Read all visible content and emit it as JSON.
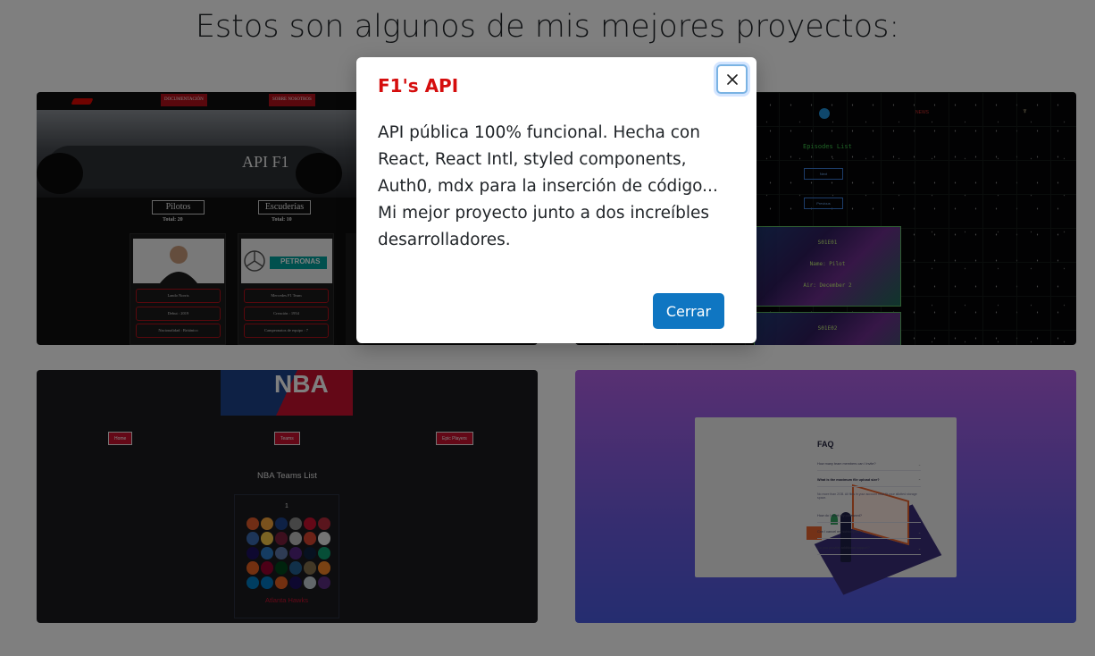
{
  "page": {
    "title": "Estos son algunos de mis mejores proyectos:"
  },
  "projects": {
    "f1": {
      "nav_buttons": [
        "DOCUMENTACIÓN",
        "SOBRE NOSOTROS"
      ],
      "hero_title": "API F1",
      "tabs": [
        {
          "label": "Pilotos",
          "total": "Total: 20"
        },
        {
          "label": "Escuderías",
          "total": "Total: 10"
        }
      ],
      "driver_card": [
        "Lando Norris",
        "Debut : 2019",
        "Nacionalidad : Británico"
      ],
      "team_card": [
        "Mercedes F1 Team",
        "Creación : 1954",
        "Campeonatos de equipo : 7"
      ],
      "sponsor_text": "PETRONAS"
    },
    "rick_morty": {
      "nav_link": "NEWS",
      "heading": "Episodes List",
      "buttons": [
        "Next",
        "Previous"
      ],
      "episode_1": [
        "S01E01",
        "Name: Pilot",
        "Air: December 2"
      ],
      "episode_2": [
        "S01E02"
      ]
    },
    "nba": {
      "logo_text": "NBA",
      "nav_buttons": [
        "Home",
        "Teams",
        "Epic Players"
      ],
      "list_title": "NBA Teams List",
      "page_number": "1",
      "team_name": "Atlanta Hawks"
    },
    "faq": {
      "title": "FAQ",
      "questions": [
        "How many team members can I invite?",
        "What is the maximum file upload size?",
        "How do I reset my password?",
        "Can I cancel my subscription?",
        "Do you provide additional support?"
      ],
      "answer": "No more than 2GB. All files in your account must fit your allotted storage space."
    }
  },
  "modal": {
    "title": "F1's API",
    "body": "API pública 100% funcional. Hecha con React, React Intl, styled components, Auth0, mdx para la inserción de código... Mi mejor proyecto junto a dos increíbles desarrolladores.",
    "close_button": "Cerrar"
  },
  "colors": {
    "modal_title": "#d50d0d",
    "primary_button": "#0f76c2",
    "f1_red": "#b3111a",
    "nba_red": "#c8102e",
    "nba_blue": "#1d428a"
  }
}
